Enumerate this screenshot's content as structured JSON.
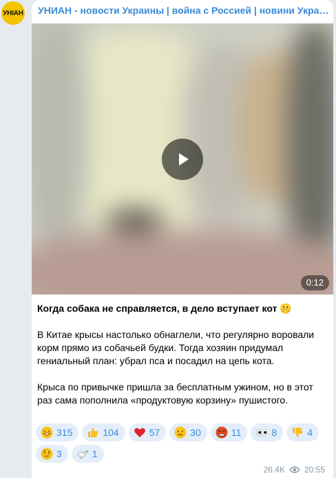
{
  "channel": {
    "name": "УНИАН - новости Украины | война с Россией | новини України | війна з Росією",
    "avatar_text": "УНIАН"
  },
  "video": {
    "duration": "0:12"
  },
  "post": {
    "headline": "Когда собака не справляется, в дело вступает кот 🤫",
    "paragraph1": "В Китае крысы настолько обнаглели, что регулярно воровали корм прямо из собачьей будки. Тогда хозяин придумал гениальный план: убрал пса и посадил на цепь кота.",
    "paragraph2": "Крыса по привычке пришла за бесплатным ужином, но в этот раз сама пополнила «продуктовую корзину» пушистого."
  },
  "reactions": [
    {
      "icon": "grinning-face-icon",
      "count": "315"
    },
    {
      "icon": "thumbs-up-icon",
      "count": "104"
    },
    {
      "icon": "red-heart-icon",
      "count": "57"
    },
    {
      "icon": "crying-face-icon",
      "count": "30"
    },
    {
      "icon": "angry-face-icon",
      "count": "11"
    },
    {
      "icon": "eyes-icon",
      "count": "8"
    },
    {
      "icon": "thumbs-down-icon",
      "count": "4"
    },
    {
      "icon": "raised-eyebrow-face-icon",
      "count": "3"
    },
    {
      "icon": "dove-icon",
      "count": "1"
    }
  ],
  "footer": {
    "views": "26.4K",
    "time": "20:55"
  },
  "colors": {
    "accent": "#3a8bd6",
    "reaction_bg": "#e4eefa",
    "avatar_bg": "#f5c400"
  }
}
